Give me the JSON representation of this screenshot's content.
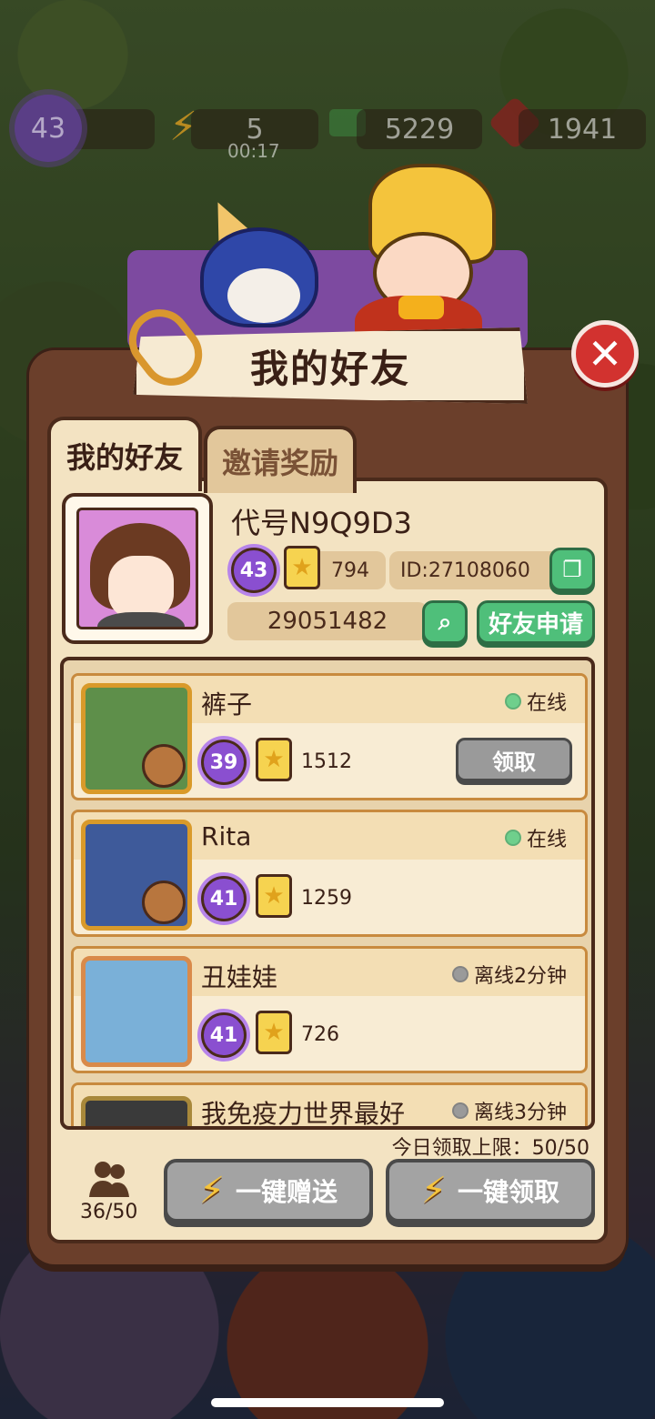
{
  "top_bar": {
    "level": "43",
    "energy": "5",
    "energy_timer": "00:17",
    "cash": "5229",
    "gems": "1941"
  },
  "dialog": {
    "title": "我的好友",
    "close_label": "✕",
    "tabs": [
      {
        "label": "我的好友",
        "active": true
      },
      {
        "label": "邀请奖励",
        "active": false
      }
    ]
  },
  "profile": {
    "name": "代号N9Q9D3",
    "level": "43",
    "score": "794",
    "id_text": "ID:27108060",
    "search_value": "29051482",
    "request_label": "好友申请"
  },
  "friends": [
    {
      "name": "裤子",
      "status": "在线",
      "online": true,
      "level": "39",
      "score": "1512",
      "claim_label": "领取"
    },
    {
      "name": "Rita",
      "status": "在线",
      "online": true,
      "level": "41",
      "score": "1259"
    },
    {
      "name": "丑娃娃",
      "status": "离线2分钟",
      "online": false,
      "level": "41",
      "score": "726"
    },
    {
      "name": "我免疫力世界最好",
      "status": "离线3分钟",
      "online": false
    }
  ],
  "footer": {
    "daily_limit": "今日领取上限：50/50",
    "friend_count": "36/50",
    "send_all_label": "一键赠送",
    "claim_all_label": "一键领取"
  },
  "icons": {
    "star": "★",
    "bolt": "⚡",
    "search": "⌕",
    "copy": "❐",
    "friends": "👥"
  }
}
